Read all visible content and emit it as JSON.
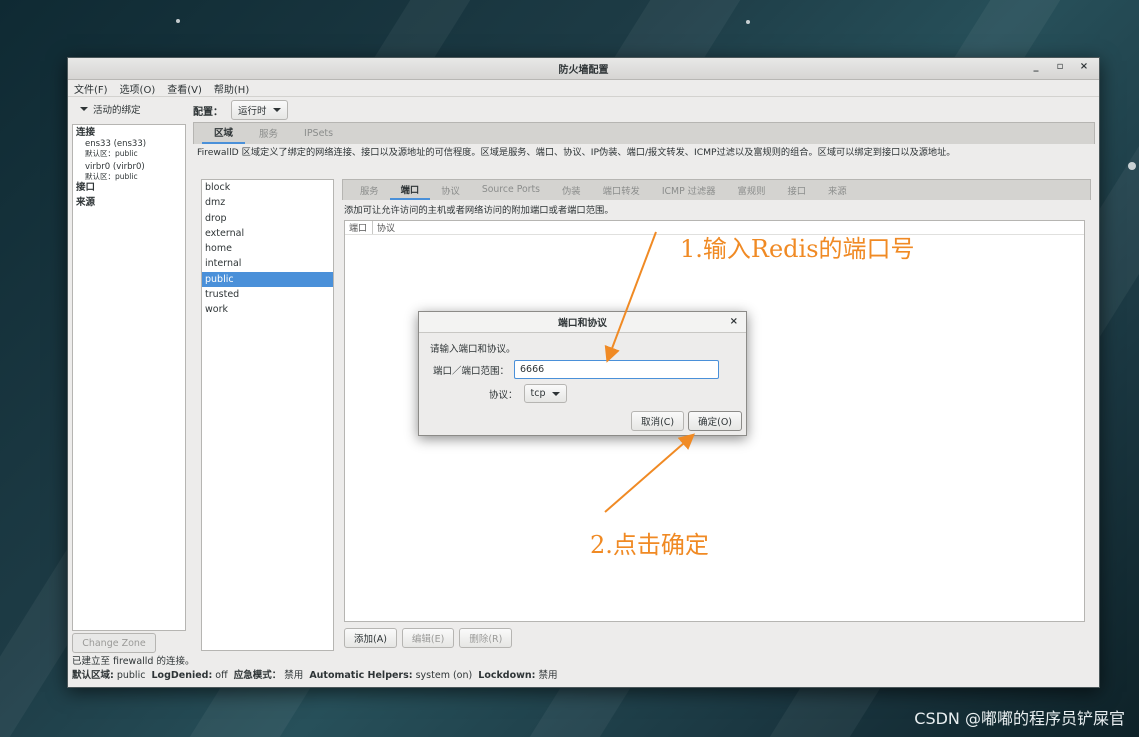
{
  "window": {
    "title": "防火墙配置",
    "controls": {
      "minimize": "_",
      "maximize": "▫",
      "close": "×"
    }
  },
  "menu": [
    "文件(F)",
    "选项(O)",
    "查看(V)",
    "帮助(H)"
  ],
  "left": {
    "binding_toggle": "活动的绑定",
    "connections_header": "连接",
    "connections": [
      {
        "name": "ens33 (ens33)",
        "zone": "默认区：public"
      },
      {
        "name": "virbr0 (virbr0)",
        "zone": "默认区：public"
      }
    ],
    "interfaces_header": "接口",
    "sources_header": "来源",
    "change_zone_button": "Change Zone"
  },
  "config": {
    "label": "配置：",
    "value": "运行时"
  },
  "top_tabs": [
    "区域",
    "服务",
    "IPSets"
  ],
  "zone_description": "FirewallD 区域定义了绑定的网络连接、接口以及源地址的可信程度。区域是服务、端口、协议、IP伪装、端口/报文转发、ICMP过滤以及富规则的组合。区域可以绑定到接口以及源地址。",
  "zones": [
    "block",
    "dmz",
    "drop",
    "external",
    "home",
    "internal",
    "public",
    "trusted",
    "work"
  ],
  "selected_zone": "public",
  "inner_tabs": [
    "服务",
    "端口",
    "协议",
    "Source Ports",
    "伪装",
    "端口转发",
    "ICMP 过滤器",
    "富规则",
    "接口",
    "来源"
  ],
  "ports_description": "添加可让允许访问的主机或者网络访问的附加端口或者端口范围。",
  "ports_table": {
    "columns": [
      "端口",
      "协议"
    ],
    "rows": []
  },
  "ports_buttons": {
    "add": "添加(A)",
    "edit": "编辑(E)",
    "delete": "删除(R)"
  },
  "status": {
    "line1": "已建立至 firewalld 的连接。",
    "default_zone_label": "默认区域:",
    "default_zone_value": "public",
    "logdenied_label": "LogDenied:",
    "logdenied_value": "off",
    "panic_label": "应急模式：",
    "panic_value": "禁用",
    "helpers_label": "Automatic Helpers:",
    "helpers_value": "system (on)",
    "lockdown_label": "Lockdown:",
    "lockdown_value": "禁用"
  },
  "dialog": {
    "title": "端口和协议",
    "close": "×",
    "message": "请输入端口和协议。",
    "port_label": "端口／端口范围：",
    "port_value": "6666",
    "protocol_label": "协议：",
    "protocol_value": "tcp",
    "cancel": "取消(C)",
    "ok": "确定(O)"
  },
  "annotations": {
    "step1": "1.输入Redis的端口号",
    "step2": "2.点击确定",
    "color": "#f08a24"
  },
  "watermark": "CSDN @嘟嘟的程序员铲屎官"
}
